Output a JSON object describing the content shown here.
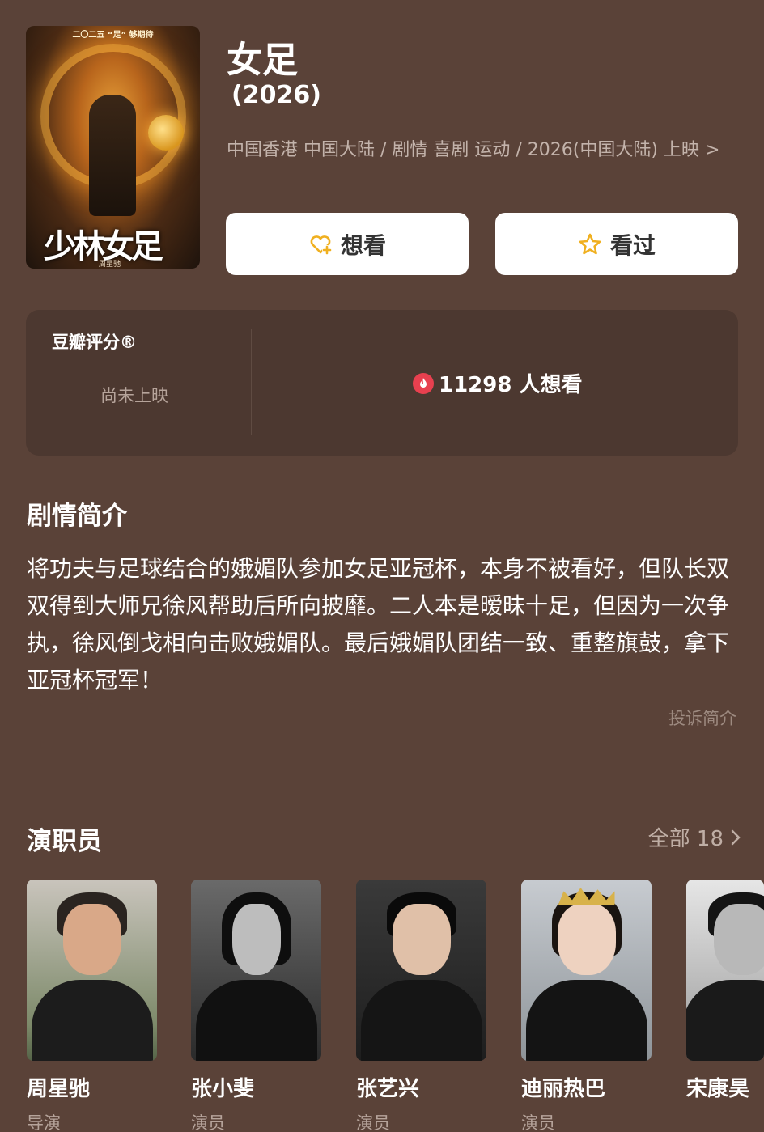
{
  "poster": {
    "top_text": "二〇二五 “足” 够期待",
    "logo_text": "少林女足",
    "director_text": "周星驰"
  },
  "movie": {
    "title": "女足",
    "year": "(2026)",
    "meta": "中国香港 中国大陆 / 剧情 喜剧 运动 / 2026(中国大陆) 上映",
    "meta_chevron": ">"
  },
  "actions": {
    "want_label": "想看",
    "seen_label": "看过"
  },
  "rating": {
    "label": "豆瓣评分®",
    "status": "尚未上映",
    "wish_count": "11298 人想看"
  },
  "synopsis": {
    "title": "剧情简介",
    "text": "将功夫与足球结合的娥媚队参加女足亚冠杯，本身不被看好，但队长双双得到大师兄徐风帮助后所向披靡。二人本是暧昧十足，但因为一次争执，徐风倒戈相向击败娥媚队。最后娥媚队团结一致、重整旗鼓，拿下亚冠杯冠军！",
    "report_label": "投诉简介"
  },
  "cast_section": {
    "title": "演职员",
    "all_label": "全部 18",
    "members": [
      {
        "name": "周星驰",
        "role": "导演"
      },
      {
        "name": "张小斐",
        "role": "演员"
      },
      {
        "name": "张艺兴",
        "role": "演员"
      },
      {
        "name": "迪丽热巴",
        "role": "演员"
      },
      {
        "name": "宋康昊",
        "role": ""
      }
    ]
  },
  "colors": {
    "background": "#5a4238",
    "card": "#4c3830",
    "accent_fire": "#e8404f",
    "icon_gold": "#f0b020"
  }
}
